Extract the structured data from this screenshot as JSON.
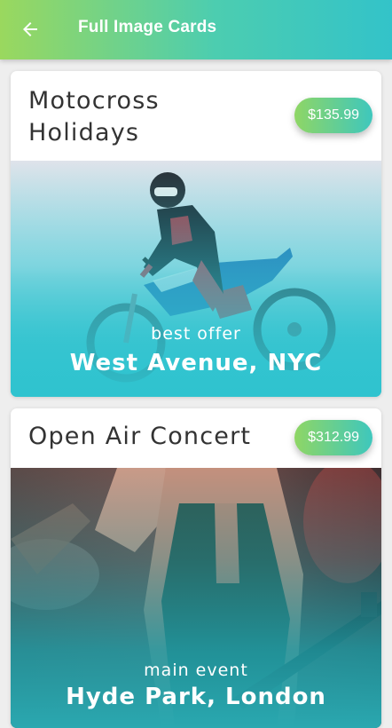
{
  "appbar": {
    "title": "Full Image Cards",
    "back_icon": "arrow-left-icon"
  },
  "colors": {
    "appbar_gradient_start": "#9ad85e",
    "appbar_gradient_end": "#33c3c9",
    "pill_gradient_start": "#8fd665",
    "pill_gradient_end": "#3ec7bd",
    "image_overlay_teal": "#2fc3cf"
  },
  "cards": [
    {
      "title": "Motocross Holidays",
      "price": "$135.99",
      "subtitle": "best offer",
      "location": "West Avenue, NYC"
    },
    {
      "title": "Open Air Concert",
      "price": "$312.99",
      "subtitle": "main event",
      "location": "Hyde Park, London"
    }
  ]
}
